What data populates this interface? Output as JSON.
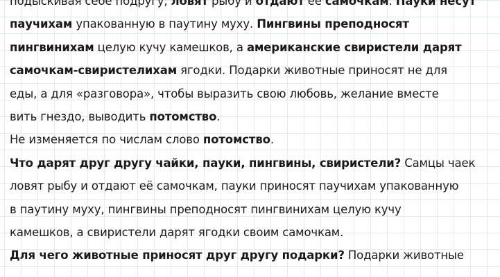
{
  "text": {
    "l1": [
      "подыскивая себе подругу, ",
      "ловят",
      " рыбу и ",
      "отдают",
      " её ",
      "самочкам",
      ". ",
      "Пауки несут",
      ""
    ],
    "l2": [
      "",
      "паучихам",
      " упакованную в паутину муху. ",
      "Пингвины преподносят",
      ""
    ],
    "l3": [
      "",
      "пингвинихам",
      " целую кучу камешков, а ",
      "американские свиристели дарят",
      ""
    ],
    "l4": [
      "",
      "самочкам-свиристелихам",
      " ягодки. Подарки животные приносят не для"
    ],
    "l5": [
      "еды, а для «разговора», чтобы выразить свою любовь, желание вместе"
    ],
    "l6": [
      "вить гнездо, выводить ",
      "потомство",
      "."
    ],
    "l7": [
      "Не изменяется по числам слово ",
      "потомство",
      "."
    ],
    "l8": [
      "",
      "Что дарят друг другу чайки, пауки, пингвины, свиристели?",
      " Самцы чаек"
    ],
    "l9": [
      "ловят рыбу и отдают её самочкам, пауки приносят паучихам упакованную"
    ],
    "l10": [
      "в паутину муху, пингвины преподносят пингвинихам целую кучу"
    ],
    "l11": [
      "камешков, а свиристели дарят ягодки своим самочкам."
    ],
    "l12": [
      "",
      "Для чего животные приносят друг другу подарки?",
      " Подарки животные"
    ]
  }
}
